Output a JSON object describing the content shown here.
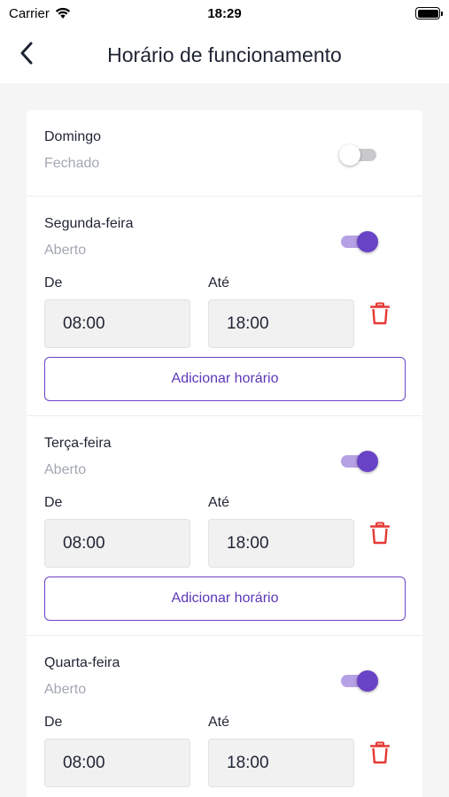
{
  "status_bar": {
    "carrier": "Carrier",
    "time": "18:29"
  },
  "header": {
    "title": "Horário de funcionamento"
  },
  "colors": {
    "accent": "#6943c6",
    "accent_light": "#b6a1e4",
    "danger": "#e53935"
  },
  "days": [
    {
      "name": "Domingo",
      "status": "Fechado",
      "enabled": false
    },
    {
      "name": "Segunda-feira",
      "status": "Aberto",
      "enabled": true,
      "ranges": [
        {
          "from_label": "De",
          "from": "08:00",
          "to_label": "Até",
          "to": "18:00"
        }
      ],
      "add_label": "Adicionar horário"
    },
    {
      "name": "Terça-feira",
      "status": "Aberto",
      "enabled": true,
      "ranges": [
        {
          "from_label": "De",
          "from": "08:00",
          "to_label": "Até",
          "to": "18:00"
        }
      ],
      "add_label": "Adicionar horário"
    },
    {
      "name": "Quarta-feira",
      "status": "Aberto",
      "enabled": true,
      "ranges": [
        {
          "from_label": "De",
          "from": "08:00",
          "to_label": "Até",
          "to": "18:00"
        }
      ]
    }
  ]
}
